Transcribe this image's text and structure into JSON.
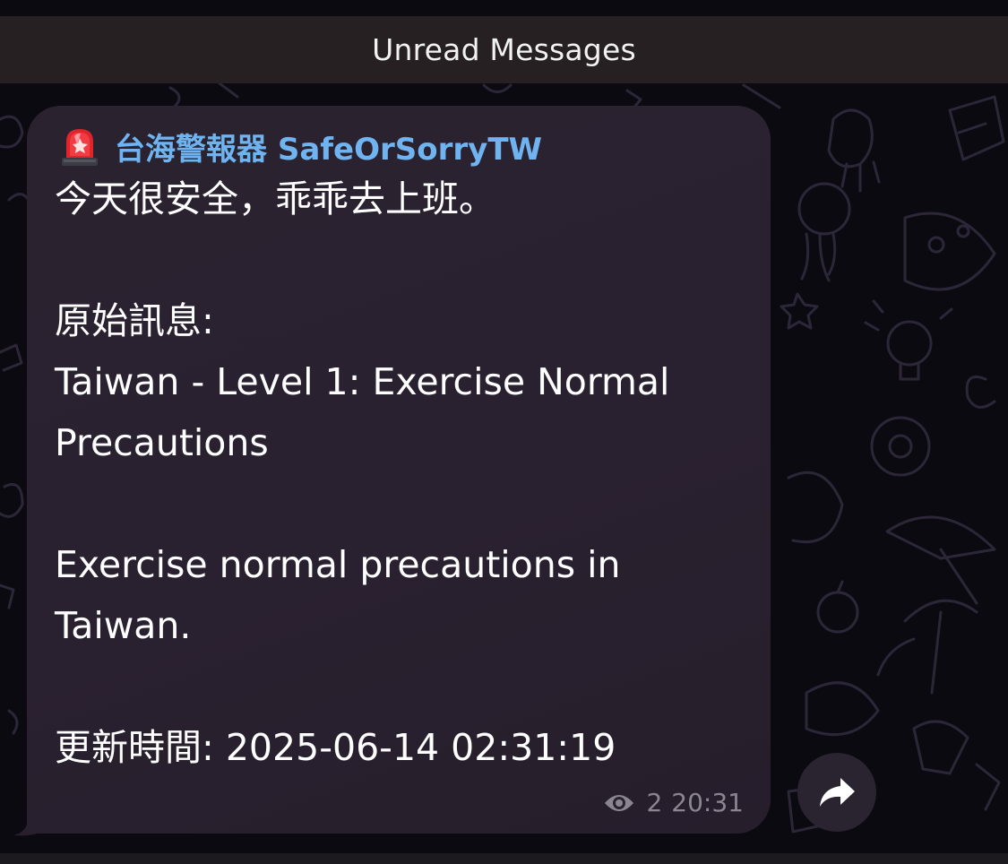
{
  "header": {
    "unread_label": "Unread Messages"
  },
  "message": {
    "sender_icon": "police-siren-icon",
    "sender_name": "台海警報器 SafeOrSorryTW",
    "lines": {
      "l1": "今天很安全，乖乖去上班。",
      "l2": "原始訊息:",
      "l3": "Taiwan - Level 1: Exercise Normal",
      "l4": "Precautions",
      "l5": "Exercise normal precautions in",
      "l6": "Taiwan.",
      "l7": "更新時間: 2025-06-14 02:31:19"
    },
    "views": "2",
    "time": "20:31"
  },
  "actions": {
    "share_icon": "share-arrow-icon"
  },
  "colors": {
    "sender_name": "#6fb4f0",
    "bubble": "#2a2130",
    "unread_bar": "#272022",
    "background": "#0b0a10"
  }
}
